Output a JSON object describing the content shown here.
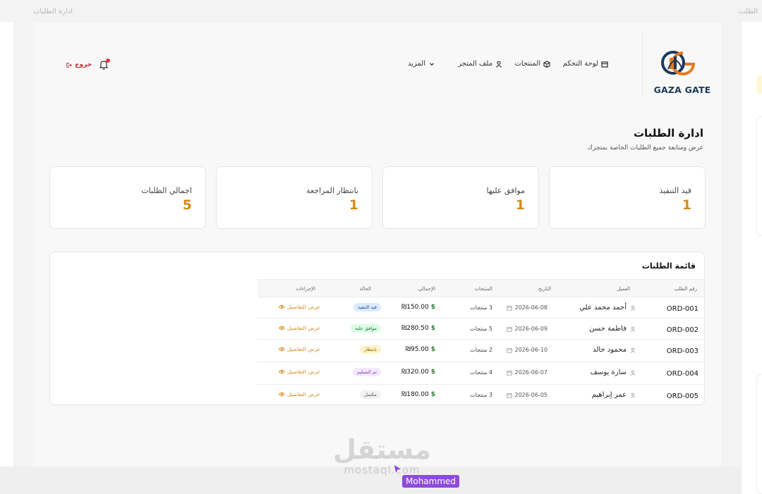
{
  "window": {
    "ghost_left_title": "ادارة الطلبات",
    "ghost_right_title": "الطلب"
  },
  "brand": {
    "name": "GAZA GATE",
    "colors": {
      "navy": "#1c3a5c",
      "orange": "#e57a20"
    }
  },
  "nav": {
    "items": [
      {
        "label": "لوحة التحكم",
        "icon": "dashboard-icon"
      },
      {
        "label": "المنتجات",
        "icon": "box-icon"
      },
      {
        "label": "ملف المتجر",
        "icon": "user-icon"
      },
      {
        "label": "المزيد",
        "icon": "chevron-down-icon"
      }
    ],
    "logout_label": "خروج",
    "notification_icon": "bell-icon"
  },
  "page": {
    "title": "ادارة الطلبات",
    "subtitle": "عرض ومتابعة جميع الطلبات الخاصة بمتجرك"
  },
  "stats": [
    {
      "label": "قيد التنفيذ",
      "value": "1"
    },
    {
      "label": "موافق عليها",
      "value": "1"
    },
    {
      "label": "بانتظار المراجعة",
      "value": "1"
    },
    {
      "label": "اجمالي الطلبات",
      "value": "5"
    }
  ],
  "table": {
    "title": "قائمة الطلبات",
    "columns": [
      "رقم الطلب",
      "العميل",
      "التاريخ",
      "المنتجات",
      "الإجمالي",
      "الحالة",
      "الإجراءات"
    ],
    "rows": [
      {
        "id": "ORD-001",
        "customer": "أحمد محمد علي",
        "date": "2026-06-08",
        "products": "3 منتجات",
        "total": "₪150.00",
        "status": "قيد التنفيذ",
        "status_color": "#dbeafe",
        "status_text_color": "#1e4fa3",
        "action": "عرض التفاصيل"
      },
      {
        "id": "ORD-002",
        "customer": "فاطمة حسن",
        "date": "2026-06-09",
        "products": "5 منتجات",
        "total": "₪280.50",
        "status": "موافق عليه",
        "status_color": "#dcfce7",
        "status_text_color": "#237a3b",
        "action": "عرض التفاصيل"
      },
      {
        "id": "ORD-003",
        "customer": "محمود خالد",
        "date": "2026-06-10",
        "products": "2 منتجات",
        "total": "₪95.00",
        "status": "بانتظار",
        "status_color": "#fef3c7",
        "status_text_color": "#8a6d0b",
        "action": "عرض التفاصيل"
      },
      {
        "id": "ORD-004",
        "customer": "سارة يوسف",
        "date": "2026-06-07",
        "products": "4 منتجات",
        "total": "₪320.00",
        "status": "تم التسليم",
        "status_color": "#f3e8ff",
        "status_text_color": "#7e3fb5",
        "action": "عرض التفاصيل"
      },
      {
        "id": "ORD-005",
        "customer": "عمر إبراهيم",
        "date": "2026-06-05",
        "products": "3 منتجات",
        "total": "₪180.00",
        "status": "مكتمل",
        "status_color": "#f1f1f1",
        "status_text_color": "#555555",
        "action": "عرض التفاصيل"
      }
    ],
    "currency_symbol": "$"
  },
  "watermark": {
    "arabic": "مستقل",
    "latin": "mostaql.com"
  },
  "cursor_tag": "Mohammed"
}
